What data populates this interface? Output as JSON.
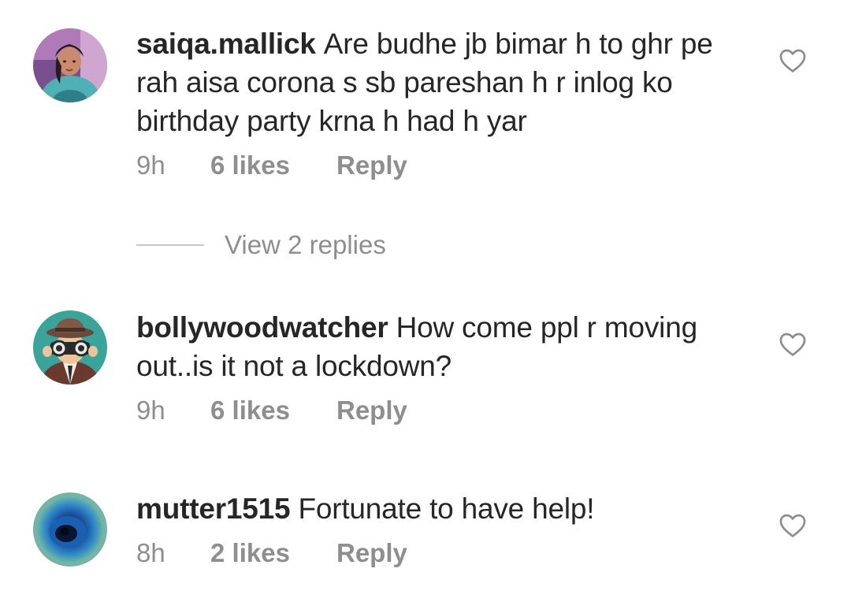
{
  "comments": [
    {
      "username": "saiqa.mallick",
      "text": "Are budhe jb bimar h to ghr pe rah aisa corona s sb pareshan h r inlog ko birthday party krna h had h yar",
      "time": "9h",
      "likes": "6 likes",
      "reply": "Reply",
      "avatar_icon": "user-avatar-photo",
      "like_icon": "heart-outline-icon"
    },
    {
      "username": "bollywoodwatcher",
      "text": "How come ppl r moving out..is it not a lockdown?",
      "time": "9h",
      "likes": "6 likes",
      "reply": "Reply",
      "avatar_icon": "binoculars-detective-avatar",
      "like_icon": "heart-outline-icon"
    },
    {
      "username": "mutter1515",
      "text": "Fortunate to have help!",
      "time": "8h",
      "likes": "2 likes",
      "reply": "Reply",
      "avatar_icon": "peacock-feather-avatar",
      "like_icon": "heart-outline-icon"
    }
  ],
  "view_replies": "View 2 replies",
  "colors": {
    "text": "#262626",
    "muted": "#8e8e8e",
    "divider": "#c7c7c7",
    "background": "#ffffff"
  }
}
